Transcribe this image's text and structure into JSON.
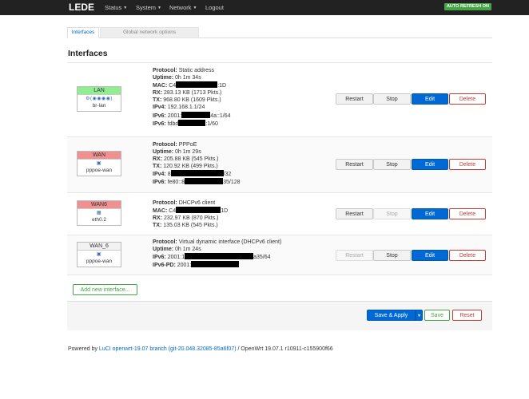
{
  "navbar": {
    "brand": "LEDE",
    "menu": [
      "Status",
      "System",
      "Network",
      "Logout"
    ],
    "auto_refresh": "AUTO REFRESH ON"
  },
  "tabs": [
    "Interfaces",
    "Global network options"
  ],
  "section_title": "Interfaces",
  "colors": {
    "lan": "#90ee90",
    "wan": "#f09090",
    "accent": "#0069d6",
    "danger": "#c43c35",
    "success": "#46a546"
  },
  "interfaces": [
    {
      "name": "LAN",
      "device": "br-lan",
      "icons": "⚙(◉◉◉◉)",
      "lines": [
        {
          "k": "Protocol:",
          "v": "Static address"
        },
        {
          "k": "Uptime:",
          "v": "0h 1m 34s"
        },
        {
          "k": "MAC:",
          "v": "C4",
          "v2": ":1D"
        },
        {
          "k": "RX:",
          "v": "283.13 KB (1713 Pkts.)"
        },
        {
          "k": "TX:",
          "v": "968.80 KB (1609 Pkts.)"
        },
        {
          "k": "IPv4:",
          "v": "192.168.1.1/24"
        },
        {
          "k": "IPv6:",
          "v": "2001:",
          "v2": "4a::1/64"
        },
        {
          "k": "IPv6:",
          "v": "fdbd",
          "v2": ":1/60"
        }
      ],
      "buttons": {
        "restart": "Restart",
        "stop": "Stop",
        "edit": "Edit",
        "delete": "Delete"
      }
    },
    {
      "name": "WAN",
      "device": "pppoe-wan",
      "icons": "▣",
      "lines": [
        {
          "k": "Protocol:",
          "v": "PPPoE"
        },
        {
          "k": "Uptime:",
          "v": "0h 1m 29s"
        },
        {
          "k": "RX:",
          "v": "205.88 KB (545 Pkts.)"
        },
        {
          "k": "TX:",
          "v": "120.92 KB (499 Pkts.)"
        },
        {
          "k": "IPv4:",
          "v": "8",
          "v2": "/32"
        },
        {
          "k": "IPv6:",
          "v": "fe80::8",
          "v2": "35/128"
        }
      ],
      "buttons": {
        "restart": "Restart",
        "stop": "Stop",
        "edit": "Edit",
        "delete": "Delete"
      }
    },
    {
      "name": "WAN6",
      "device": "eth0.2",
      "icons": "▦",
      "lines": [
        {
          "k": "Protocol:",
          "v": "DHCPv6 client"
        },
        {
          "k": "MAC:",
          "v": "C4",
          "v2": "1D"
        },
        {
          "k": "RX:",
          "v": "232.97 KB (870 Pkts.)"
        },
        {
          "k": "TX:",
          "v": "135.03 KB (545 Pkts.)"
        }
      ],
      "buttons": {
        "restart": "Restart",
        "stop": "Stop",
        "edit": "Edit",
        "delete": "Delete"
      }
    },
    {
      "name": "WAN_6",
      "device": "pppoe-wan",
      "icons": "▣",
      "lines": [
        {
          "k": "Protocol:",
          "v": "Virtual dynamic interface (DHCPv6 client)"
        },
        {
          "k": "Uptime:",
          "v": "0h 1m 24s"
        },
        {
          "k": "IPv6:",
          "v": "2001:1",
          "v2": "a35/64"
        },
        {
          "k": "IPv6-PD:",
          "v": "2001:"
        }
      ],
      "buttons": {
        "restart": "Restart",
        "stop": "Stop",
        "edit": "Edit",
        "delete": "Delete"
      }
    }
  ],
  "add_interface": "Add new interface...",
  "footer_buttons": {
    "save_apply": "Save & Apply",
    "save": "Save",
    "reset": "Reset"
  },
  "powered": {
    "prefix": "Powered by ",
    "link": "LuCI openwrt-19.07 branch (git-20.048.32085-85a6f07)",
    "suffix": " / OpenWrt 19.07.1 r10911-c155900f66"
  }
}
